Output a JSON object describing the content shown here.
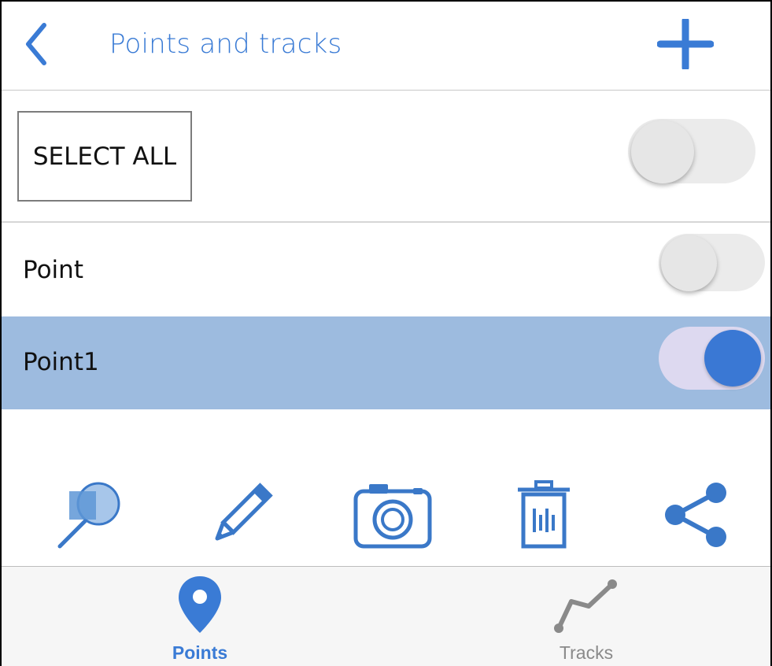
{
  "header": {
    "title": "Points and tracks",
    "back_icon": "chevron-left-icon",
    "add_icon": "plus-icon"
  },
  "select_all": {
    "label": "SELECT ALL",
    "toggle_on": false
  },
  "items": [
    {
      "label": "Point",
      "toggle_on": false,
      "selected": false
    },
    {
      "label": "Point1",
      "toggle_on": true,
      "selected": true
    }
  ],
  "toolbar": {
    "icons": [
      "zoom-to-icon",
      "pencil-icon",
      "camera-icon",
      "trash-icon",
      "share-icon"
    ]
  },
  "tabs": [
    {
      "label": "Points",
      "icon": "location-pin-icon",
      "active": true
    },
    {
      "label": "Tracks",
      "icon": "track-icon",
      "active": false
    }
  ],
  "colors": {
    "accent": "#3a7bd5",
    "selected_row": "#9dbbdf",
    "tab_inactive": "#8a8a8a"
  }
}
